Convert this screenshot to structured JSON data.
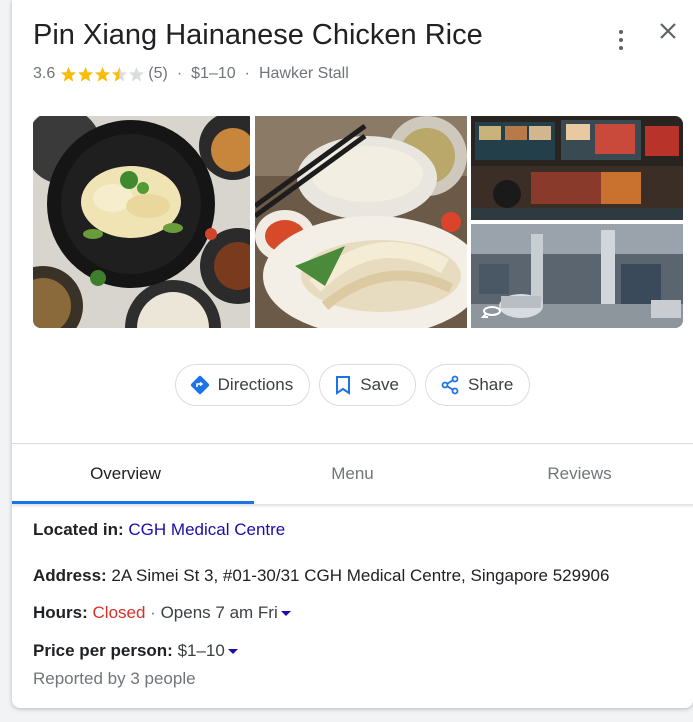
{
  "place": {
    "name": "Pin Xiang Hainanese Chicken Rice",
    "rating": "3.6",
    "rating_value": 3.6,
    "review_count": "(5)",
    "price": "$1–10",
    "category": "Hawker Stall",
    "separator": "·"
  },
  "photos": [
    {
      "icon": "photo-chicken-rice-spread"
    },
    {
      "icon": "photo-chicken-rice-plate"
    },
    {
      "icon": "photo-stall-front"
    },
    {
      "icon": "photo-street-view",
      "overlay_icon": "street-view-360-icon"
    }
  ],
  "actions": {
    "directions": "Directions",
    "save": "Save",
    "share": "Share"
  },
  "tabs": {
    "overview": "Overview",
    "menu": "Menu",
    "reviews": "Reviews"
  },
  "details": {
    "located_label": "Located in:",
    "located_value": "CGH Medical Centre",
    "address_label": "Address:",
    "address_value": "2A Simei St 3, #01-30/31 CGH Medical Centre, Singapore 529906",
    "hours_label": "Hours:",
    "hours_status": "Closed",
    "hours_separator": "·",
    "hours_next": "Opens 7 am Fri",
    "price_label": "Price per person:",
    "price_value": "$1–10",
    "price_note": "Reported by 3 people"
  },
  "colors": {
    "star": "#fbbc04",
    "accent": "#1a73e8",
    "link": "#1a0dab",
    "closed": "#d93025"
  }
}
